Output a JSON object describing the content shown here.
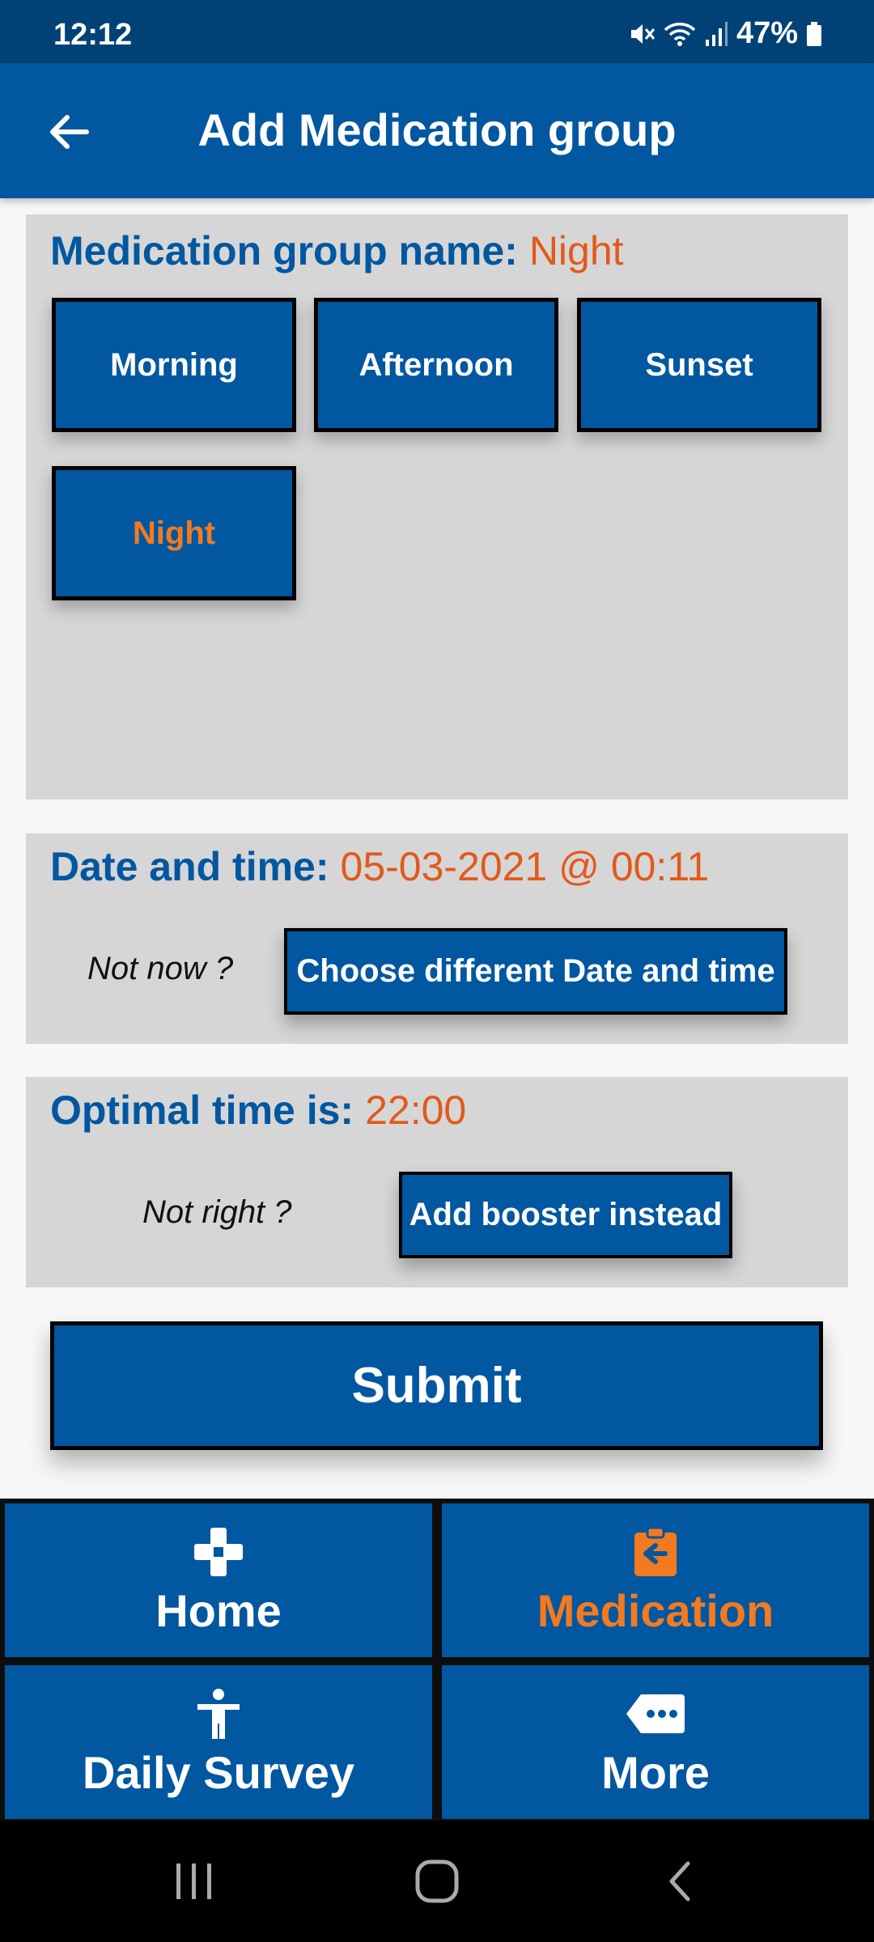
{
  "status_bar": {
    "time": "12:12",
    "battery": "47%",
    "icons": [
      "mute-icon",
      "wifi-icon",
      "signal-icon",
      "battery-icon"
    ]
  },
  "app_bar": {
    "title": "Add Medication group",
    "back_icon": "arrow-left-icon"
  },
  "group_panel": {
    "label": "Medication group name:",
    "value": "Night",
    "options": [
      {
        "label": "Morning",
        "selected": false
      },
      {
        "label": "Afternoon",
        "selected": false
      },
      {
        "label": "Sunset",
        "selected": false
      },
      {
        "label": "Night",
        "selected": true
      }
    ]
  },
  "date_panel": {
    "label": "Date and time:",
    "value": "05-03-2021 @ 00:11",
    "hint": "Not now ?",
    "button_label": "Choose different Date and time"
  },
  "optimal_panel": {
    "label": "Optimal time is:",
    "value": "22:00",
    "hint": "Not right ?",
    "button_label": "Add booster instead"
  },
  "submit_label": "Submit",
  "bottom_nav": [
    {
      "label": "Home",
      "icon": "medical-cross-icon",
      "active": false
    },
    {
      "label": "Medication",
      "icon": "clipboard-arrow-icon",
      "active": true
    },
    {
      "label": "Daily Survey",
      "icon": "person-accessibility-icon",
      "active": false
    },
    {
      "label": "More",
      "icon": "more-tag-icon",
      "active": false
    }
  ],
  "colors": {
    "primary": "#0157a0",
    "status_bar": "#004276",
    "accent": "#f37a1f",
    "value_text": "#e2591a",
    "panel_bg": "#d6d6d6"
  }
}
